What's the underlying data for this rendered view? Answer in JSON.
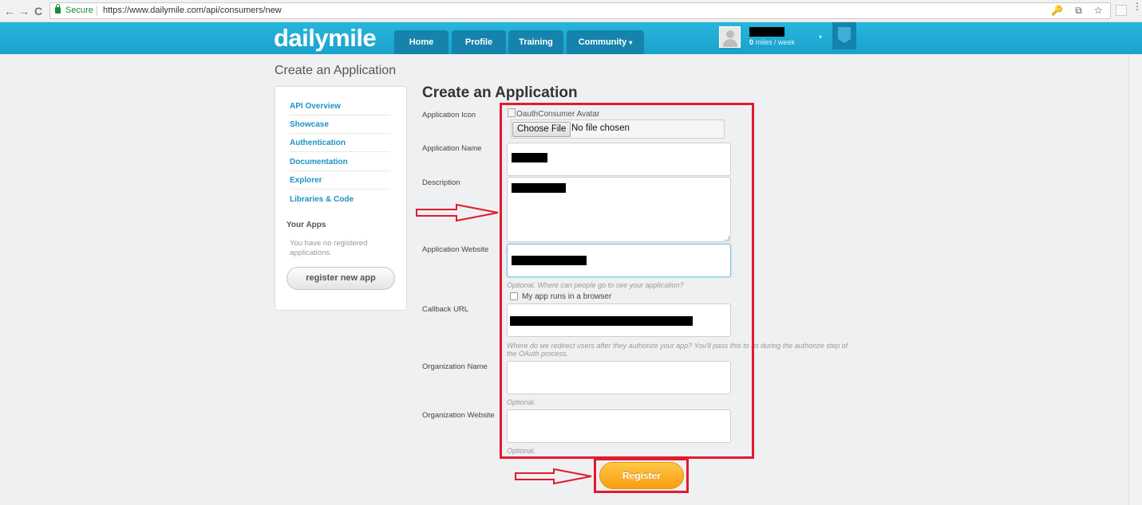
{
  "browser": {
    "secure_label": "Secure",
    "url": "https://www.dailymile.com/api/consumers/new",
    "back": "←",
    "forward": "→",
    "reload": "C",
    "omni_icons": "🔑 ⧉ ☆",
    "menu": "⋮"
  },
  "header": {
    "logo": "dailymile",
    "tabs": [
      {
        "label": "Home"
      },
      {
        "label": "Profile"
      },
      {
        "label": "Training"
      },
      {
        "label": "Community"
      }
    ],
    "community_caret": "▾",
    "user_caret": "▾",
    "miles_value": "0",
    "miles_unit": "miles / week"
  },
  "page": {
    "heading": "Create an Application"
  },
  "sidebar": {
    "links": [
      {
        "label": "API Overview"
      },
      {
        "label": "Showcase"
      },
      {
        "label": "Authentication"
      },
      {
        "label": "Documentation"
      },
      {
        "label": "Explorer"
      },
      {
        "label": "Libraries & Code"
      }
    ],
    "your_apps_title": "Your Apps",
    "no_apps_text": "You have no registered applications.",
    "register_new_label": "register new app"
  },
  "form": {
    "title": "Create an Application",
    "icon_label": "Application Icon",
    "avatar_alt": "OauthConsumer Avatar",
    "choose_file": "Choose File",
    "no_file": "No file chosen",
    "name_label": "Application Name",
    "description_label": "Description",
    "website_label": "Application Website",
    "website_hint": "Optional. Where can people go to see your application?",
    "browser_checkbox_label": "My app runs in a browser",
    "callback_label": "Callback URL",
    "callback_hint": "Where do we redirect users after they authorize your app? You'll pass this to us during the authorize step of the OAuth process.",
    "org_name_label": "Organization Name",
    "org_name_hint": "Optional.",
    "org_website_label": "Organization Website",
    "org_website_hint": "Optional.",
    "register_label": "Register"
  },
  "colors": {
    "header": "#1aa1cd",
    "tab": "#1683ad",
    "link": "#1c93c4",
    "register": "#f99d0f",
    "annotation": "#e21b2d"
  }
}
